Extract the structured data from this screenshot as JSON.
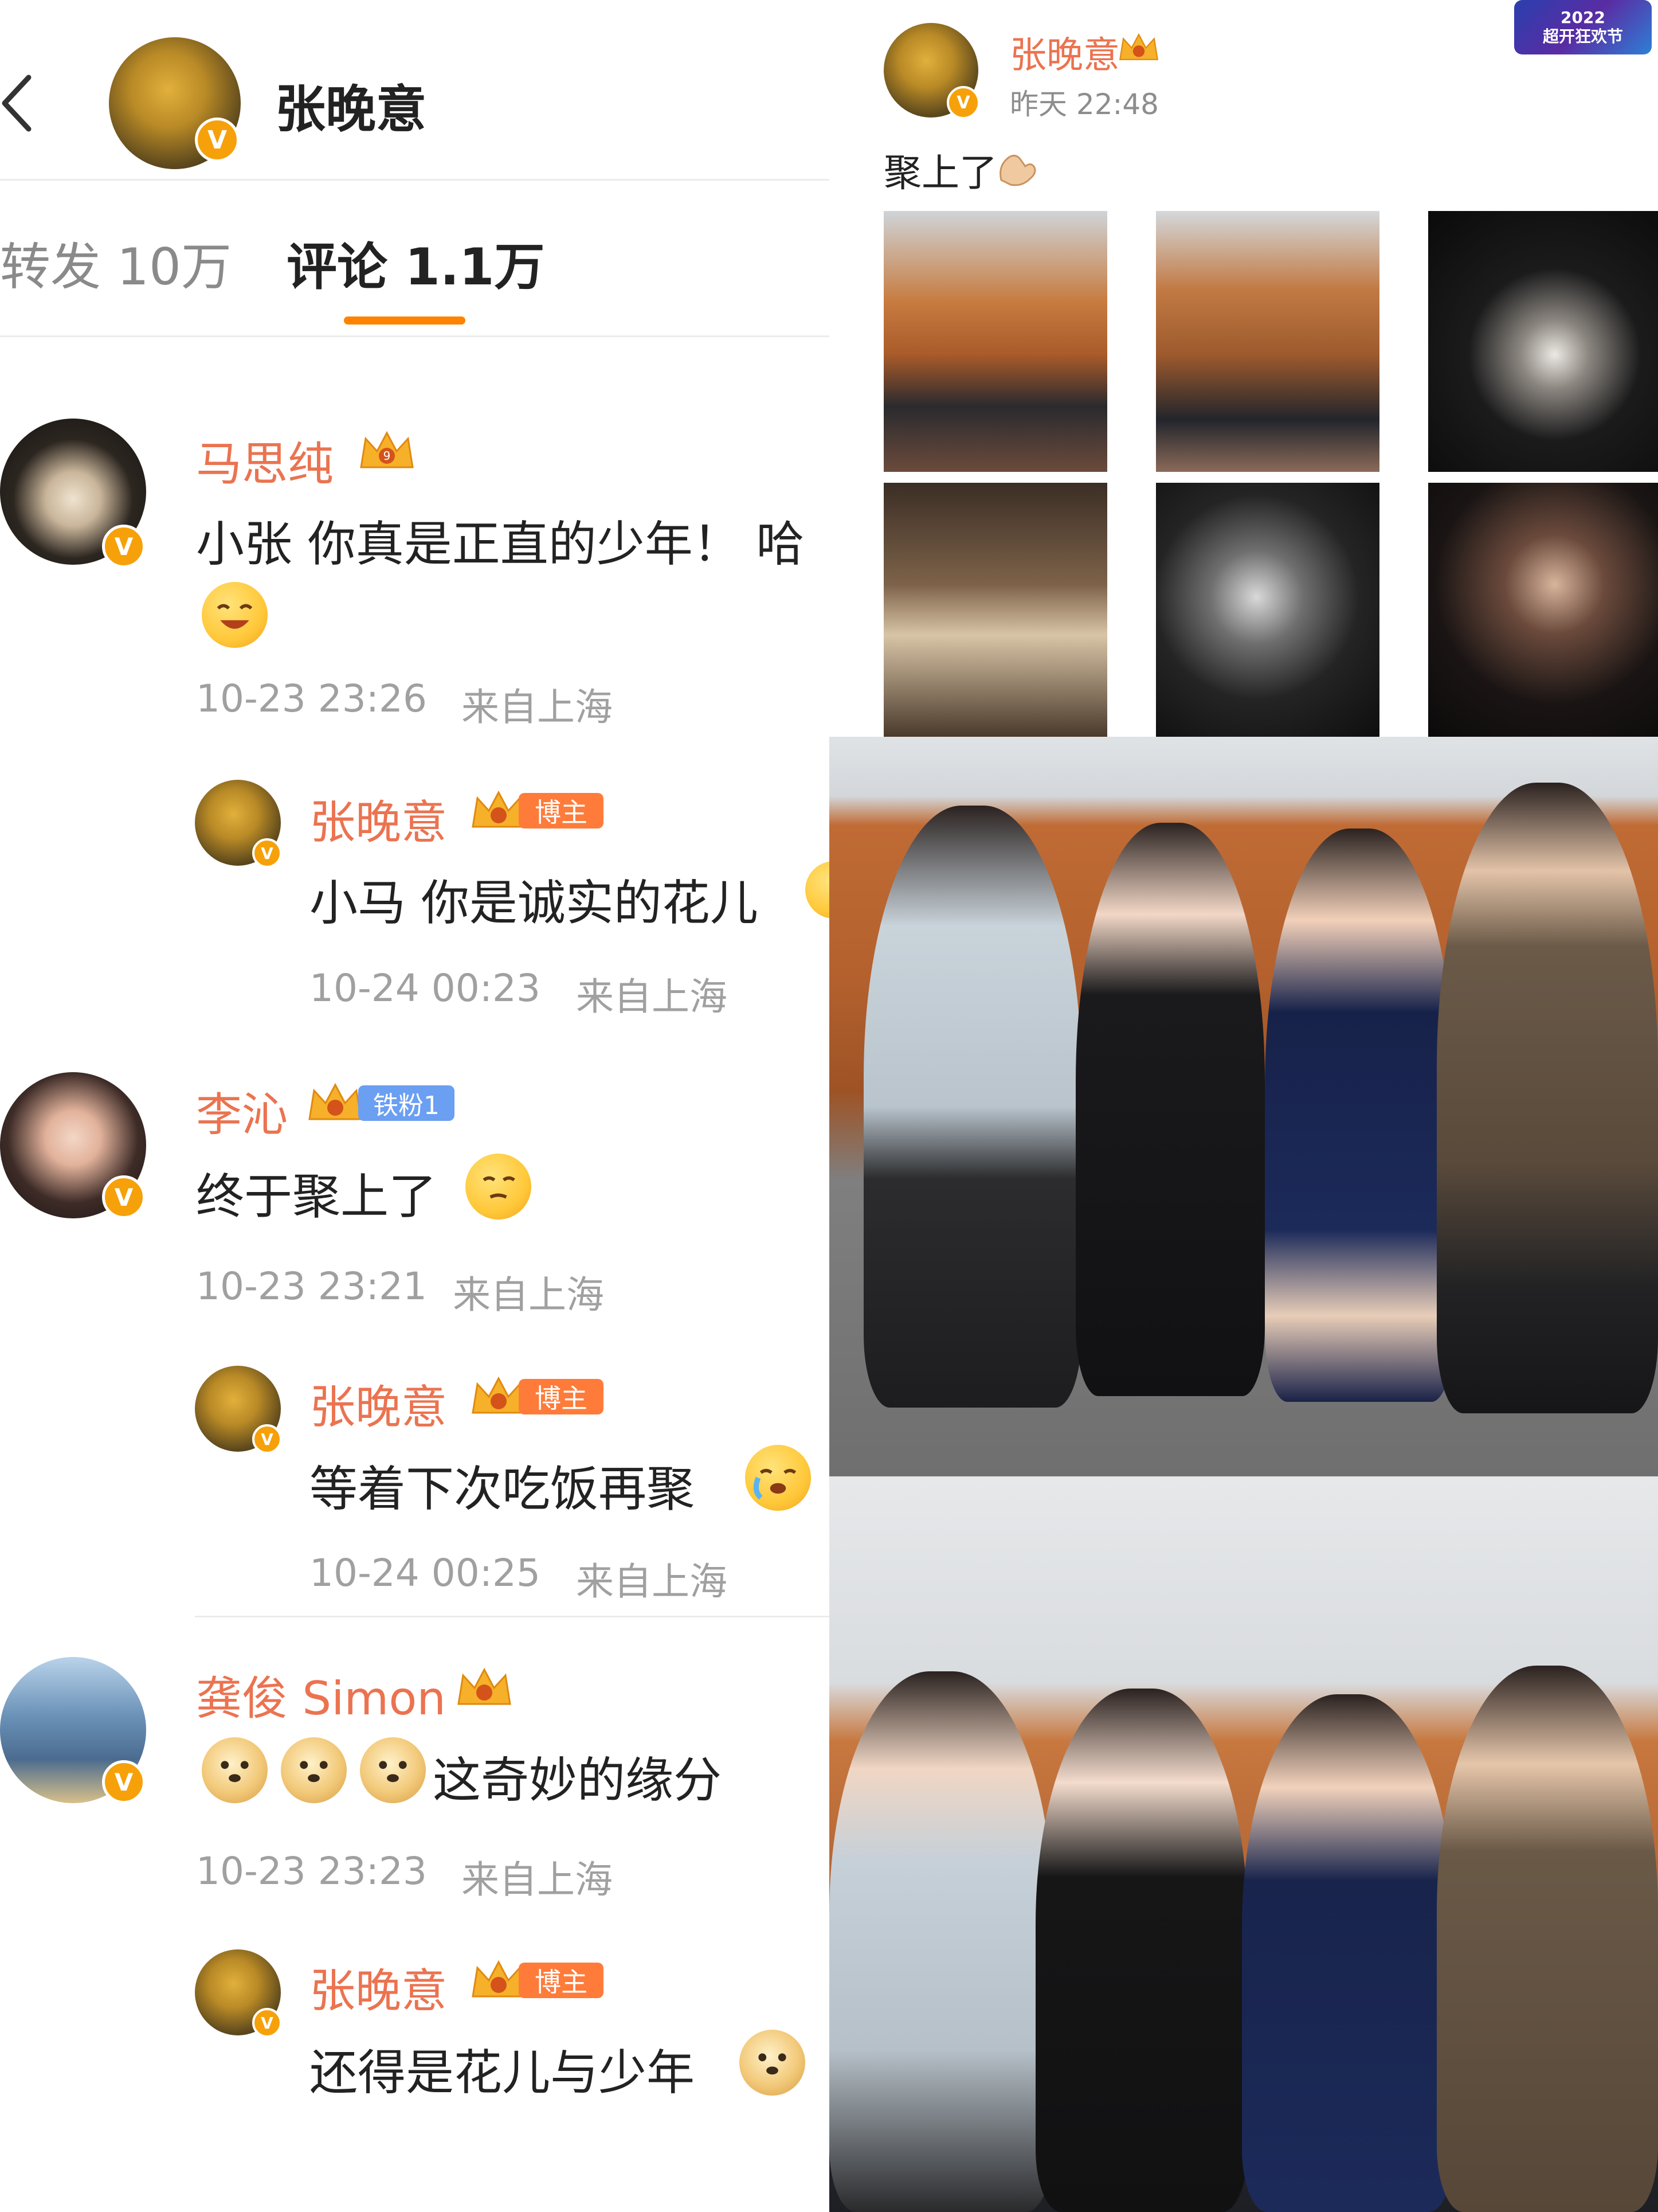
{
  "left": {
    "header": {
      "name": "张晚意"
    },
    "tabs": [
      {
        "label": "转发 10万",
        "active": false
      },
      {
        "label": "评论 1.1万",
        "active": true
      }
    ],
    "accent_color": "#ff8200",
    "name_color": "#eb7350",
    "comments": [
      {
        "user": "马思纯",
        "text": "小张 你真是正直的少年！ 哈",
        "time": "10-23 23:26",
        "location": "来自上海",
        "reply": {
          "user": "张晚意",
          "badge": "博主",
          "text": "小马 你是诚实的花儿",
          "time": "10-24 00:23",
          "location": "来自上海"
        }
      },
      {
        "user": "李沁",
        "fan_badge": "铁粉1",
        "text": "终于聚上了",
        "time": "10-23 23:21",
        "location": "来自上海",
        "reply": {
          "user": "张晚意",
          "badge": "博主",
          "text": "等着下次吃饭再聚",
          "time": "10-24 00:25",
          "location": "来自上海"
        }
      },
      {
        "user": "龚俊 Simon",
        "text": "这奇妙的缘分",
        "time": "10-23 23:23",
        "location": "来自上海",
        "reply": {
          "user": "张晚意",
          "badge": "博主",
          "text": "还得是花儿与少年",
          "time": "",
          "location": ""
        }
      }
    ]
  },
  "right": {
    "post": {
      "user": "张晚意",
      "time": "昨天 22:48",
      "text": "聚上了",
      "banner_line1": "2022",
      "banner_line2": "超开狂欢节"
    }
  }
}
